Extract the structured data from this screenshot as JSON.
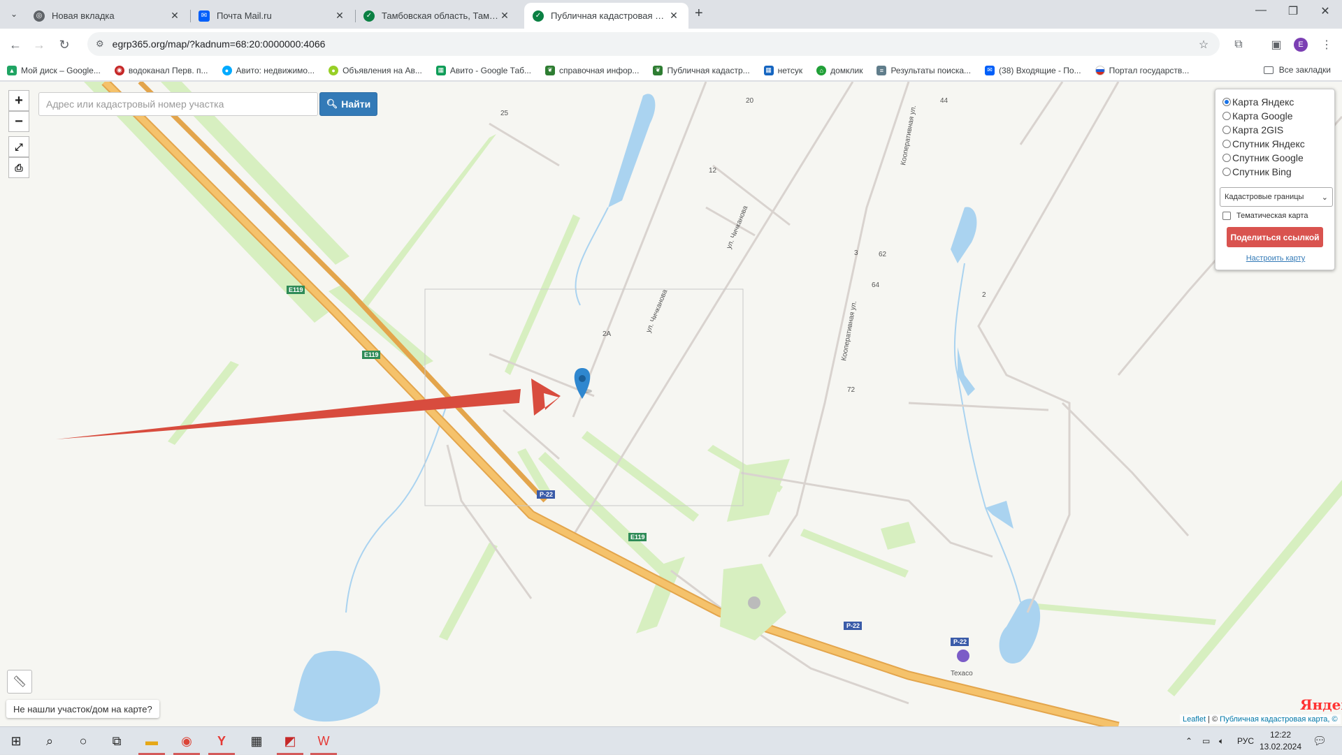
{
  "browser": {
    "tabs": [
      {
        "title": "Новая вкладка",
        "favicon": "chrome-icon",
        "color": "#5f6368",
        "active": false
      },
      {
        "title": "Почта Mail.ru",
        "favicon": "mail-icon",
        "color": "#005ff9",
        "active": false
      },
      {
        "title": "Тамбовская область, Тамбовс",
        "favicon": "check-icon",
        "color": "#0b8043",
        "active": false
      },
      {
        "title": "Публичная кадастровая карта",
        "favicon": "check-icon",
        "color": "#0b8043",
        "active": true
      }
    ],
    "url": "egrp365.org/map/?kadnum=68:20:0000000:4066",
    "profile_initial": "E",
    "bookmarks": [
      {
        "label": "Мой диск – Google...",
        "icon": "gdrive-icon",
        "color": "#1fa463"
      },
      {
        "label": "водоканал Перв. п...",
        "icon": "drop-icon",
        "color": "#c62828"
      },
      {
        "label": "Авито: недвижимо...",
        "icon": "avito-icon",
        "color": "#00aaff"
      },
      {
        "label": "Объявления на Ав...",
        "icon": "avito-icon",
        "color": "#97cf26"
      },
      {
        "label": "Авито - Google Таб...",
        "icon": "sheets-icon",
        "color": "#0f9d58"
      },
      {
        "label": "справочная инфор...",
        "icon": "leaf-icon",
        "color": "#2e7d32"
      },
      {
        "label": "Публичная кадастр...",
        "icon": "leaf-icon",
        "color": "#2e7d32"
      },
      {
        "label": "нетсук",
        "icon": "grid-icon",
        "color": "#1565c0"
      },
      {
        "label": "домклик",
        "icon": "domclick-icon",
        "color": "#21a038"
      },
      {
        "label": "Результаты поиска...",
        "icon": "doc-icon",
        "color": "#607d8b"
      },
      {
        "label": "(38) Входящие - По...",
        "icon": "mail-icon",
        "color": "#005ff9"
      },
      {
        "label": "Портал государств...",
        "icon": "flag-icon",
        "color": "#d52b1e"
      }
    ],
    "all_bookmarks": "Все закладки"
  },
  "map": {
    "search_placeholder": "Адрес или кадастровый номер участка",
    "find_button": "Найти",
    "layers": [
      {
        "label": "Карта Яндекс",
        "selected": true
      },
      {
        "label": "Карта Google",
        "selected": false
      },
      {
        "label": "Карта 2GIS",
        "selected": false
      },
      {
        "label": "Спутник Яндекс",
        "selected": false
      },
      {
        "label": "Спутник Google",
        "selected": false
      },
      {
        "label": "Спутник Bing",
        "selected": false
      }
    ],
    "boundary_select": "Кадастровые границы",
    "thematic_label": "Тематическая карта",
    "share_button": "Поделиться ссылкой",
    "configure_link": "Настроить карту",
    "not_found": "Не нашли участок/дом на карте?",
    "provider_logo": "Яндекс",
    "attribution_leaflet": "Leaflet",
    "attribution_separator": " | © ",
    "attribution_rest": "Публичная кадастровая карта, ©",
    "street_labels": [
      "ул. Чичканова",
      "ул. Чичканова",
      "Кооперативная ул.",
      "Кооперативная ул."
    ],
    "house_numbers": [
      "25",
      "20",
      "12",
      "44",
      "2А",
      "3",
      "62",
      "64",
      "72",
      "2"
    ],
    "road_shields": [
      "E119",
      "E119",
      "P-22",
      "E119",
      "P-22",
      "P-22"
    ],
    "poi": "Texaco",
    "colors": {
      "road_major": "#f5c26b",
      "road_edge": "#e3a54c",
      "water": "#aad3f0",
      "green": "#d7efc0",
      "arrow": "#d84c3e",
      "marker": "#2f87cf"
    }
  },
  "taskbar": {
    "lang": "РУС",
    "time": "12:22",
    "date": "13.02.2024"
  }
}
